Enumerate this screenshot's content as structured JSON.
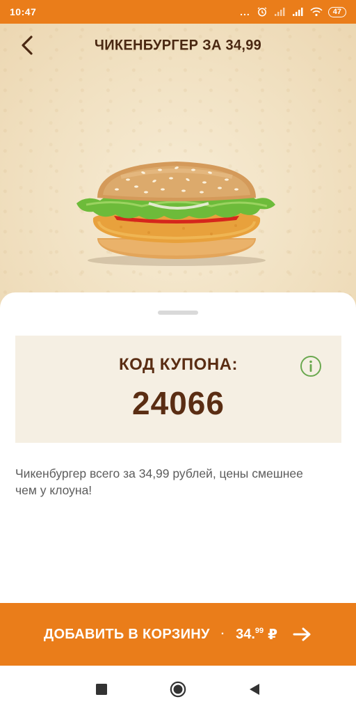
{
  "status_bar": {
    "time": "10:47",
    "dots": "...",
    "battery": "47",
    "icons": [
      "alarm-icon",
      "signal-icon",
      "signal-icon",
      "wifi-icon",
      "battery-icon"
    ]
  },
  "header": {
    "title": "ЧИКЕНБУРГЕР ЗА 34,99",
    "back_icon": "chevron-left-icon"
  },
  "coupon": {
    "label": "КОД КУПОНА:",
    "code": "24066",
    "info_icon": "info-icon"
  },
  "description": "Чикенбургер всего за 34,99 рублей, цены смешнее чем у клоуна!",
  "cta": {
    "label": "ДОБАВИТЬ В КОРЗИНУ",
    "separator": "·",
    "price_main": "34.",
    "price_cents": "99",
    "currency": "₽",
    "arrow_icon": "arrow-right-icon"
  },
  "nav": {
    "icons": [
      "square-recents-icon",
      "circle-home-icon",
      "triangle-back-icon"
    ]
  },
  "colors": {
    "accent": "#ea7d1a",
    "brand_brown": "#5a2d13",
    "coupon_bg": "#f5efe3",
    "info_green": "#6aa84f"
  }
}
